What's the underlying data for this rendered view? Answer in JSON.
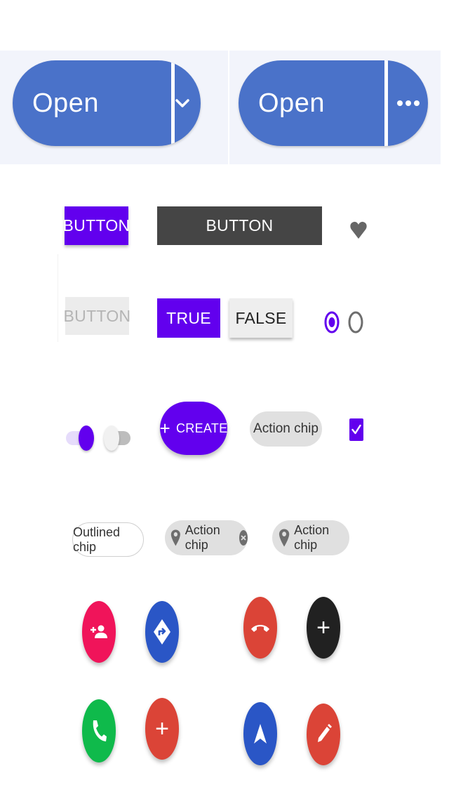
{
  "split_buttons": [
    {
      "label": "Open",
      "menu_glyph": "⌄"
    },
    {
      "label": "Open",
      "menu_glyph": "•••"
    }
  ],
  "buttons": {
    "contained": "BUTTON",
    "dark": "BUTTON",
    "disabled": "BUTTON",
    "toggle_true": "TRUE",
    "toggle_false": "FALSE",
    "extended_fab": "CREATE",
    "extended_fab_icon": "+"
  },
  "chips": {
    "action_chip": "Action chip",
    "outlined_chip": "Outlined chip",
    "action_chip_with_close": "Action chip",
    "action_chip_with_pin": "Action chip"
  },
  "selection": {
    "radio_selected": true,
    "radio_unselected": false,
    "switch_on": true,
    "switch_off": false,
    "checkbox_checked": true
  },
  "icons": {
    "favorite": "heart-icon",
    "add": "+",
    "fabs": [
      {
        "name": "add-person-icon",
        "color": "#f0145a"
      },
      {
        "name": "directions-icon",
        "color": "#2a56c6"
      },
      {
        "name": "call-end-icon",
        "color": "#db4437"
      },
      {
        "name": "plus-icon",
        "color": "#212121"
      },
      {
        "name": "phone-icon",
        "color": "#0fba4b"
      },
      {
        "name": "plus-icon",
        "color": "#db4437"
      },
      {
        "name": "navigation-icon",
        "color": "#2a56c6"
      },
      {
        "name": "edit-icon",
        "color": "#db4437"
      }
    ]
  },
  "colors": {
    "primary": "#6200ee",
    "split_blue": "#4a72c9",
    "chip_gray": "#e0e0e0"
  }
}
